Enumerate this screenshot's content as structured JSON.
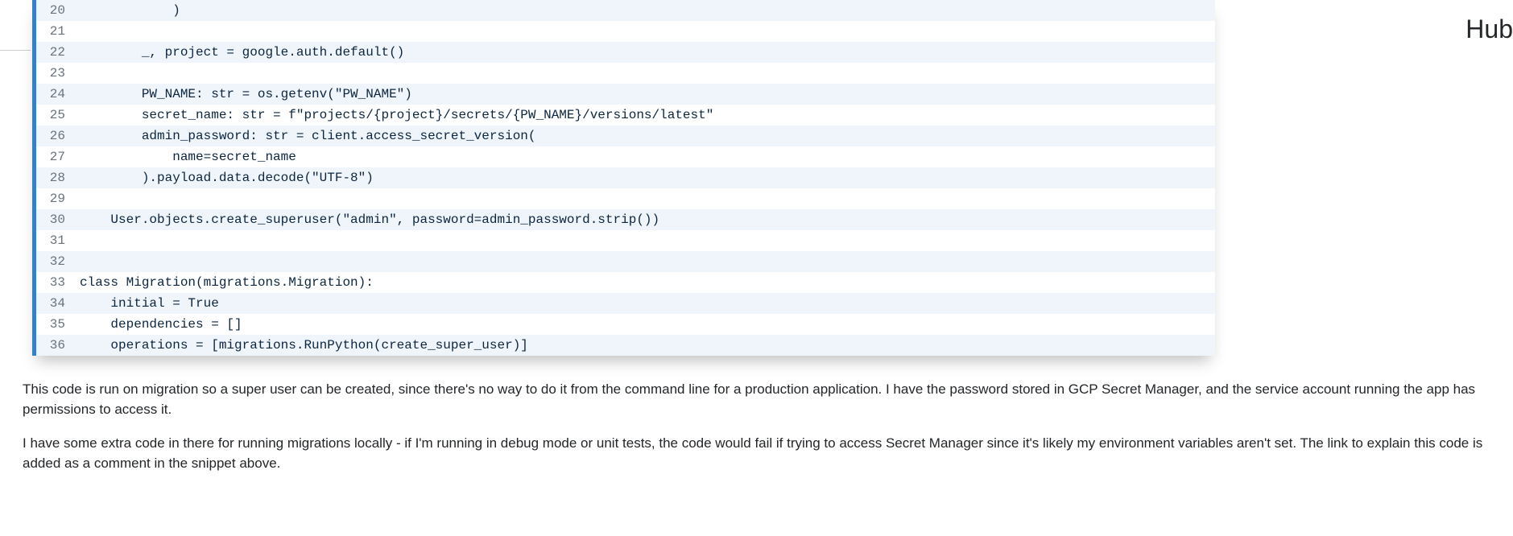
{
  "code": {
    "lines": [
      {
        "n": 20,
        "t": "            )"
      },
      {
        "n": 21,
        "t": ""
      },
      {
        "n": 22,
        "t": "        _, project = google.auth.default()"
      },
      {
        "n": 23,
        "t": ""
      },
      {
        "n": 24,
        "t": "        PW_NAME: str = os.getenv(\"PW_NAME\")"
      },
      {
        "n": 25,
        "t": "        secret_name: str = f\"projects/{project}/secrets/{PW_NAME}/versions/latest\""
      },
      {
        "n": 26,
        "t": "        admin_password: str = client.access_secret_version("
      },
      {
        "n": 27,
        "t": "            name=secret_name"
      },
      {
        "n": 28,
        "t": "        ).payload.data.decode(\"UTF-8\")"
      },
      {
        "n": 29,
        "t": ""
      },
      {
        "n": 30,
        "t": "    User.objects.create_superuser(\"admin\", password=admin_password.strip())"
      },
      {
        "n": 31,
        "t": ""
      },
      {
        "n": 32,
        "t": ""
      },
      {
        "n": 33,
        "t": "class Migration(migrations.Migration):"
      },
      {
        "n": 34,
        "t": "    initial = True"
      },
      {
        "n": 35,
        "t": "    dependencies = []"
      },
      {
        "n": 36,
        "t": "    operations = [migrations.RunPython(create_super_user)]"
      }
    ]
  },
  "prose": {
    "p1": "This code is run on migration so a super user can be created, since there's no way to do it from the command line for a production application. I have the password stored in GCP Secret Manager, and the service account running the app has permissions to access it.",
    "p2": "I have some extra code in there for running migrations locally - if I'm running in debug mode or unit tests, the code would fail if trying to access Secret Manager since it's likely my environment variables aren't set. The link to explain this code is added as a comment in the snippet above."
  },
  "fragment": {
    "hub": "Hub"
  }
}
